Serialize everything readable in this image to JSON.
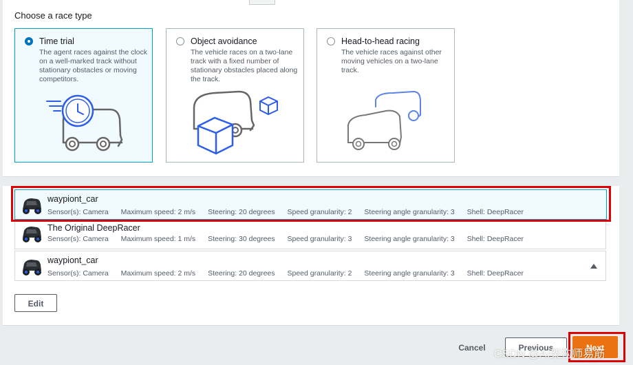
{
  "section": {
    "heading": "Choose a race type"
  },
  "race_types": [
    {
      "title": "Time trial",
      "description": "The agent races against the clock on a well-marked track without stationary obstacles or moving competitors.",
      "selected": true
    },
    {
      "title": "Object avoidance",
      "description": "The vehicle races on a two-lane track with a fixed number of stationary obstacles placed along the track.",
      "selected": false
    },
    {
      "title": "Head-to-head racing",
      "description": "The vehicle races against other moving vehicles on a two-lane track.",
      "selected": false
    }
  ],
  "models": [
    {
      "name": "waypiont_car",
      "sensors": "Sensor(s): Camera",
      "max_speed": "Maximum speed: 2 m/s",
      "steering": "Steering: 20 degrees",
      "speed_gran": "Speed granularity: 2",
      "steer_gran": "Steering angle granularity: 3",
      "shell": "Shell: DeepRacer"
    },
    {
      "name": "The Original DeepRacer",
      "sensors": "Sensor(s): Camera",
      "max_speed": "Maximum speed: 1 m/s",
      "steering": "Steering: 30 degrees",
      "speed_gran": "Speed granularity: 3",
      "steer_gran": "Steering angle granularity: 3",
      "shell": "Shell: DeepRacer"
    },
    {
      "name": "waypiont_car",
      "sensors": "Sensor(s): Camera",
      "max_speed": "Maximum speed: 2 m/s",
      "steering": "Steering: 20 degrees",
      "speed_gran": "Speed granularity: 2",
      "steer_gran": "Steering angle granularity: 3",
      "shell": "Shell: DeepRacer"
    }
  ],
  "buttons": {
    "edit": "Edit",
    "cancel": "Cancel",
    "previous": "Previous",
    "next": "Next"
  },
  "watermark": "CSDN @AI架构师易筋",
  "colors": {
    "accent": "#0073bb",
    "selected_border": "#00a1c9",
    "primary_button": "#ec7211",
    "highlight": "#e00000"
  }
}
